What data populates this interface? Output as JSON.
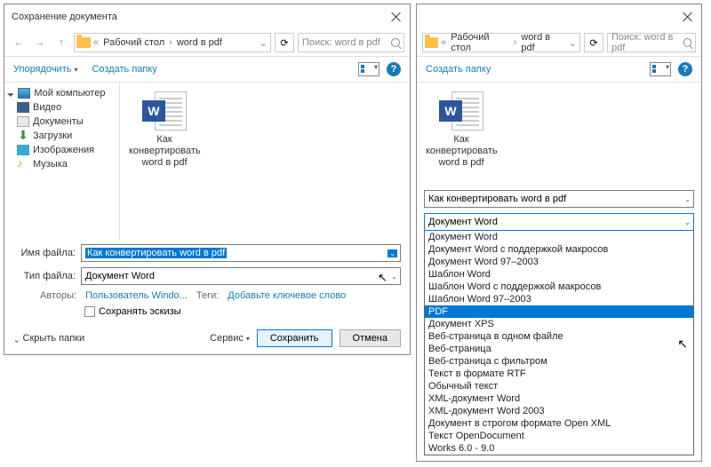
{
  "left": {
    "title": "Сохранение документа",
    "breadcrumb": {
      "sep": "«",
      "item1": "Рабочий стол",
      "item2": "word в pdf"
    },
    "search_placeholder": "Поиск: word в pdf",
    "toolbar": {
      "organize": "Упорядочить",
      "new_folder": "Создать папку"
    },
    "tree": {
      "root": "Мой компьютер",
      "video": "Видео",
      "docs": "Документы",
      "dl": "Загрузки",
      "img": "Изображения",
      "music": "Музыка"
    },
    "file": {
      "name": "Как конвертировать word в pdf"
    },
    "form": {
      "filename_label": "Имя файла:",
      "filename_value": "Как конвертировать word  в  pdf",
      "type_label": "Тип файла:",
      "type_value": "Документ Word",
      "authors_label": "Авторы:",
      "authors_value": "Пользователь Windo...",
      "tags_label": "Теги:",
      "tags_value": "Добавьте ключевое слово",
      "thumb_chk": "Сохранять эскизы"
    },
    "footer": {
      "hide": "Скрыть папки",
      "service": "Сервис",
      "save": "Сохранить",
      "cancel": "Отмена"
    }
  },
  "right": {
    "breadcrumb": {
      "sep": "«",
      "item1": "Рабочий стол",
      "item2": "word в pdf"
    },
    "search_placeholder": "Поиск: word в pdf",
    "toolbar": {
      "new_folder": "Создать папку"
    },
    "file": {
      "name": "Как конвертировать word в pdf"
    },
    "filename_value": "Как конвертировать word  в  pdf",
    "type_value": "Документ Word",
    "options": [
      "Документ Word",
      "Документ Word с поддержкой макросов",
      "Документ Word 97–2003",
      "Шаблон Word",
      "Шаблон Word с поддержкой макросов",
      "Шаблон Word 97–2003",
      "PDF",
      "Документ XPS",
      "Веб-страница в одном файле",
      "Веб-страница",
      "Веб-страница с фильтром",
      "Текст в формате RTF",
      "Обычный текст",
      "XML-документ Word",
      "XML-документ Word 2003",
      "Документ в строгом формате Open XML",
      "Текст OpenDocument",
      "Works 6.0 - 9.0"
    ],
    "highlight_index": 6
  }
}
